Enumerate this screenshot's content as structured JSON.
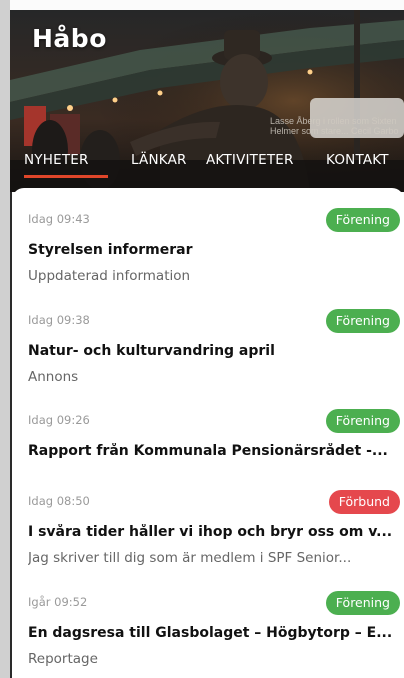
{
  "app": {
    "title": "Håbo"
  },
  "hero": {
    "caption": "Lasse Åberg i rollen som Sixten Helmer som stare... Cecil Garbo"
  },
  "tabs": [
    {
      "label": "NYHETER",
      "active": true
    },
    {
      "label": "LÄNKAR",
      "active": false
    },
    {
      "label": "AKTIVITETER",
      "active": false
    },
    {
      "label": "KONTAKT",
      "active": false
    }
  ],
  "news": [
    {
      "time": "Idag 09:43",
      "tag": "Förening",
      "tag_color": "#4caf50",
      "title": "Styrelsen informerar",
      "subtitle": "Uppdaterad information"
    },
    {
      "time": "Idag 09:38",
      "tag": "Förening",
      "tag_color": "#4caf50",
      "title": "Natur- och kulturvandring april",
      "subtitle": "Annons"
    },
    {
      "time": "Idag 09:26",
      "tag": "Förening",
      "tag_color": "#4caf50",
      "title": "Rapport från Kommunala Pensionärsrådet -...",
      "subtitle": ""
    },
    {
      "time": "Idag 08:50",
      "tag": "Förbund",
      "tag_color": "#e5484d",
      "title": "I svåra tider håller vi ihop och bryr oss om v...",
      "subtitle": "Jag skriver till dig som är medlem i SPF Senior..."
    },
    {
      "time": "Igår 09:52",
      "tag": "Förening",
      "tag_color": "#4caf50",
      "title": "En dagsresa till Glasbolaget – Högbytorp – E...",
      "subtitle": "Reportage"
    }
  ],
  "colors": {
    "accent": "#e0462a",
    "tag_green": "#4caf50",
    "tag_red": "#e5484d"
  }
}
